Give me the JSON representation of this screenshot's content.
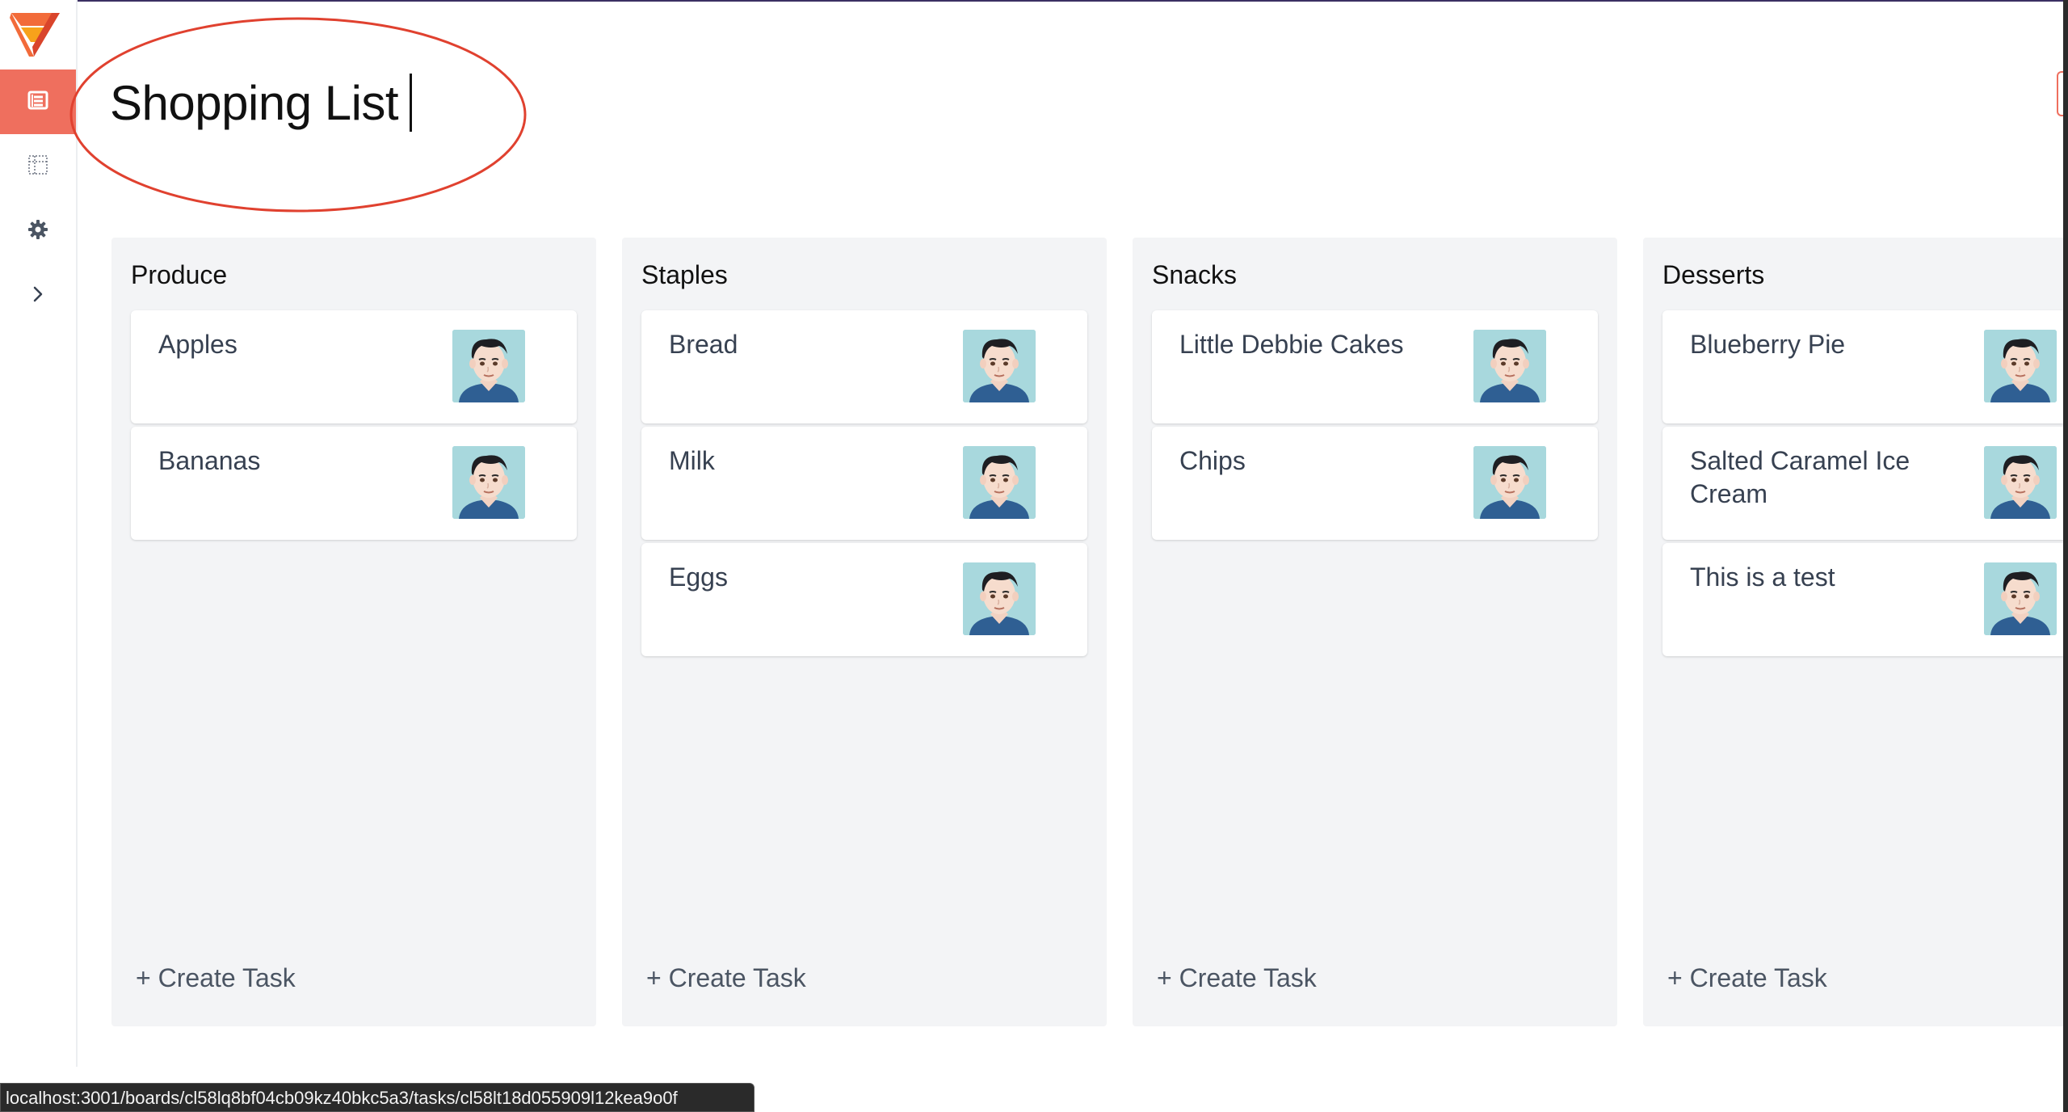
{
  "header": {
    "title": "Shopping List"
  },
  "sidebar": {
    "logo_icon": "logo-icon",
    "items": [
      {
        "icon": "list-view-icon",
        "active": true
      },
      {
        "icon": "board-view-icon",
        "active": false
      },
      {
        "icon": "gear-icon",
        "active": false
      },
      {
        "icon": "chevron-right-icon",
        "active": false
      }
    ]
  },
  "board": {
    "create_label": "+ Create Task",
    "columns": [
      {
        "title": "Produce",
        "cards": [
          {
            "text": "Apples"
          },
          {
            "text": "Bananas"
          }
        ]
      },
      {
        "title": "Staples",
        "cards": [
          {
            "text": "Bread"
          },
          {
            "text": "Milk"
          },
          {
            "text": "Eggs"
          }
        ]
      },
      {
        "title": "Snacks",
        "cards": [
          {
            "text": "Little Debbie Cakes"
          },
          {
            "text": "Chips"
          }
        ]
      },
      {
        "title": "Desserts",
        "cards": [
          {
            "text": "Blueberry Pie"
          },
          {
            "text": "Salted Caramel Ice Cream"
          },
          {
            "text": "This is a test"
          }
        ]
      }
    ]
  },
  "status_bar": {
    "url": "localhost:3001/boards/cl58lq8bf04cb09kz40bkc5a3/tasks/cl58lt18d055909l12kea9o0f"
  },
  "colors": {
    "accent": "#ef6f5e",
    "column_bg": "#f3f4f6",
    "annotation": "#e0412f"
  }
}
